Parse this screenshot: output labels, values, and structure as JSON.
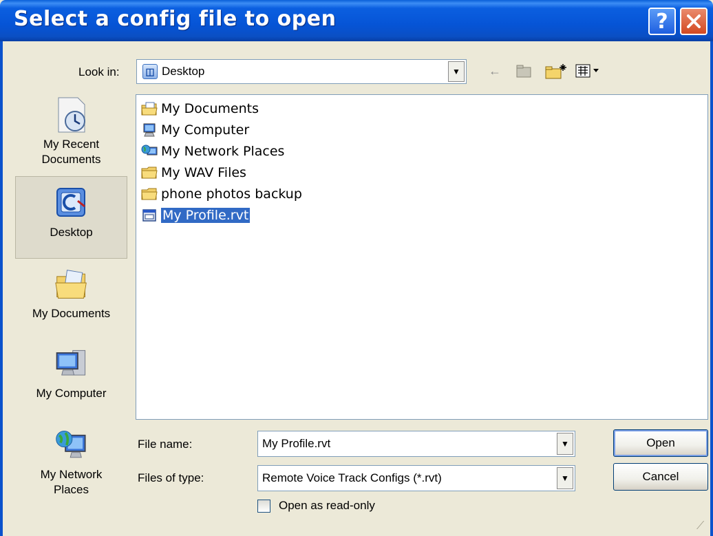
{
  "window": {
    "title": "Select a config file to open",
    "help_label": "?",
    "close_label": "✕"
  },
  "lookin": {
    "label": "Look in:",
    "value": "Desktop"
  },
  "toolbar": {
    "back_icon": "←",
    "up_icon": "▥",
    "new_folder_icon": "✱",
    "view_icon": "▦▾"
  },
  "places": [
    {
      "label_line1": "My Recent",
      "label_line2": "Documents",
      "icon": "recent-documents-icon"
    },
    {
      "label_line1": "Desktop",
      "label_line2": "",
      "icon": "desktop-icon"
    },
    {
      "label_line1": "My Documents",
      "label_line2": "",
      "icon": "my-documents-icon"
    },
    {
      "label_line1": "My Computer",
      "label_line2": "",
      "icon": "my-computer-icon"
    },
    {
      "label_line1": "My Network",
      "label_line2": "Places",
      "icon": "network-places-icon"
    }
  ],
  "files": [
    {
      "name": "My Documents",
      "type": "documents-folder"
    },
    {
      "name": "My Computer",
      "type": "computer"
    },
    {
      "name": "My Network Places",
      "type": "network"
    },
    {
      "name": "My WAV Files",
      "type": "folder"
    },
    {
      "name": "phone photos backup",
      "type": "folder"
    },
    {
      "name": "My Profile.rvt",
      "type": "rvt-file",
      "selected": true
    }
  ],
  "form": {
    "filename_label": "File name:",
    "filename_value": "My Profile.rvt",
    "filetype_label": "Files of type:",
    "filetype_value": "Remote Voice Track Configs (*.rvt)",
    "readonly_label": "Open as read-only"
  },
  "buttons": {
    "open": "Open",
    "cancel": "Cancel"
  },
  "colors": {
    "titlebar": "#0654d6",
    "selection": "#316ac5",
    "dialog_bg": "#ece9d8"
  }
}
